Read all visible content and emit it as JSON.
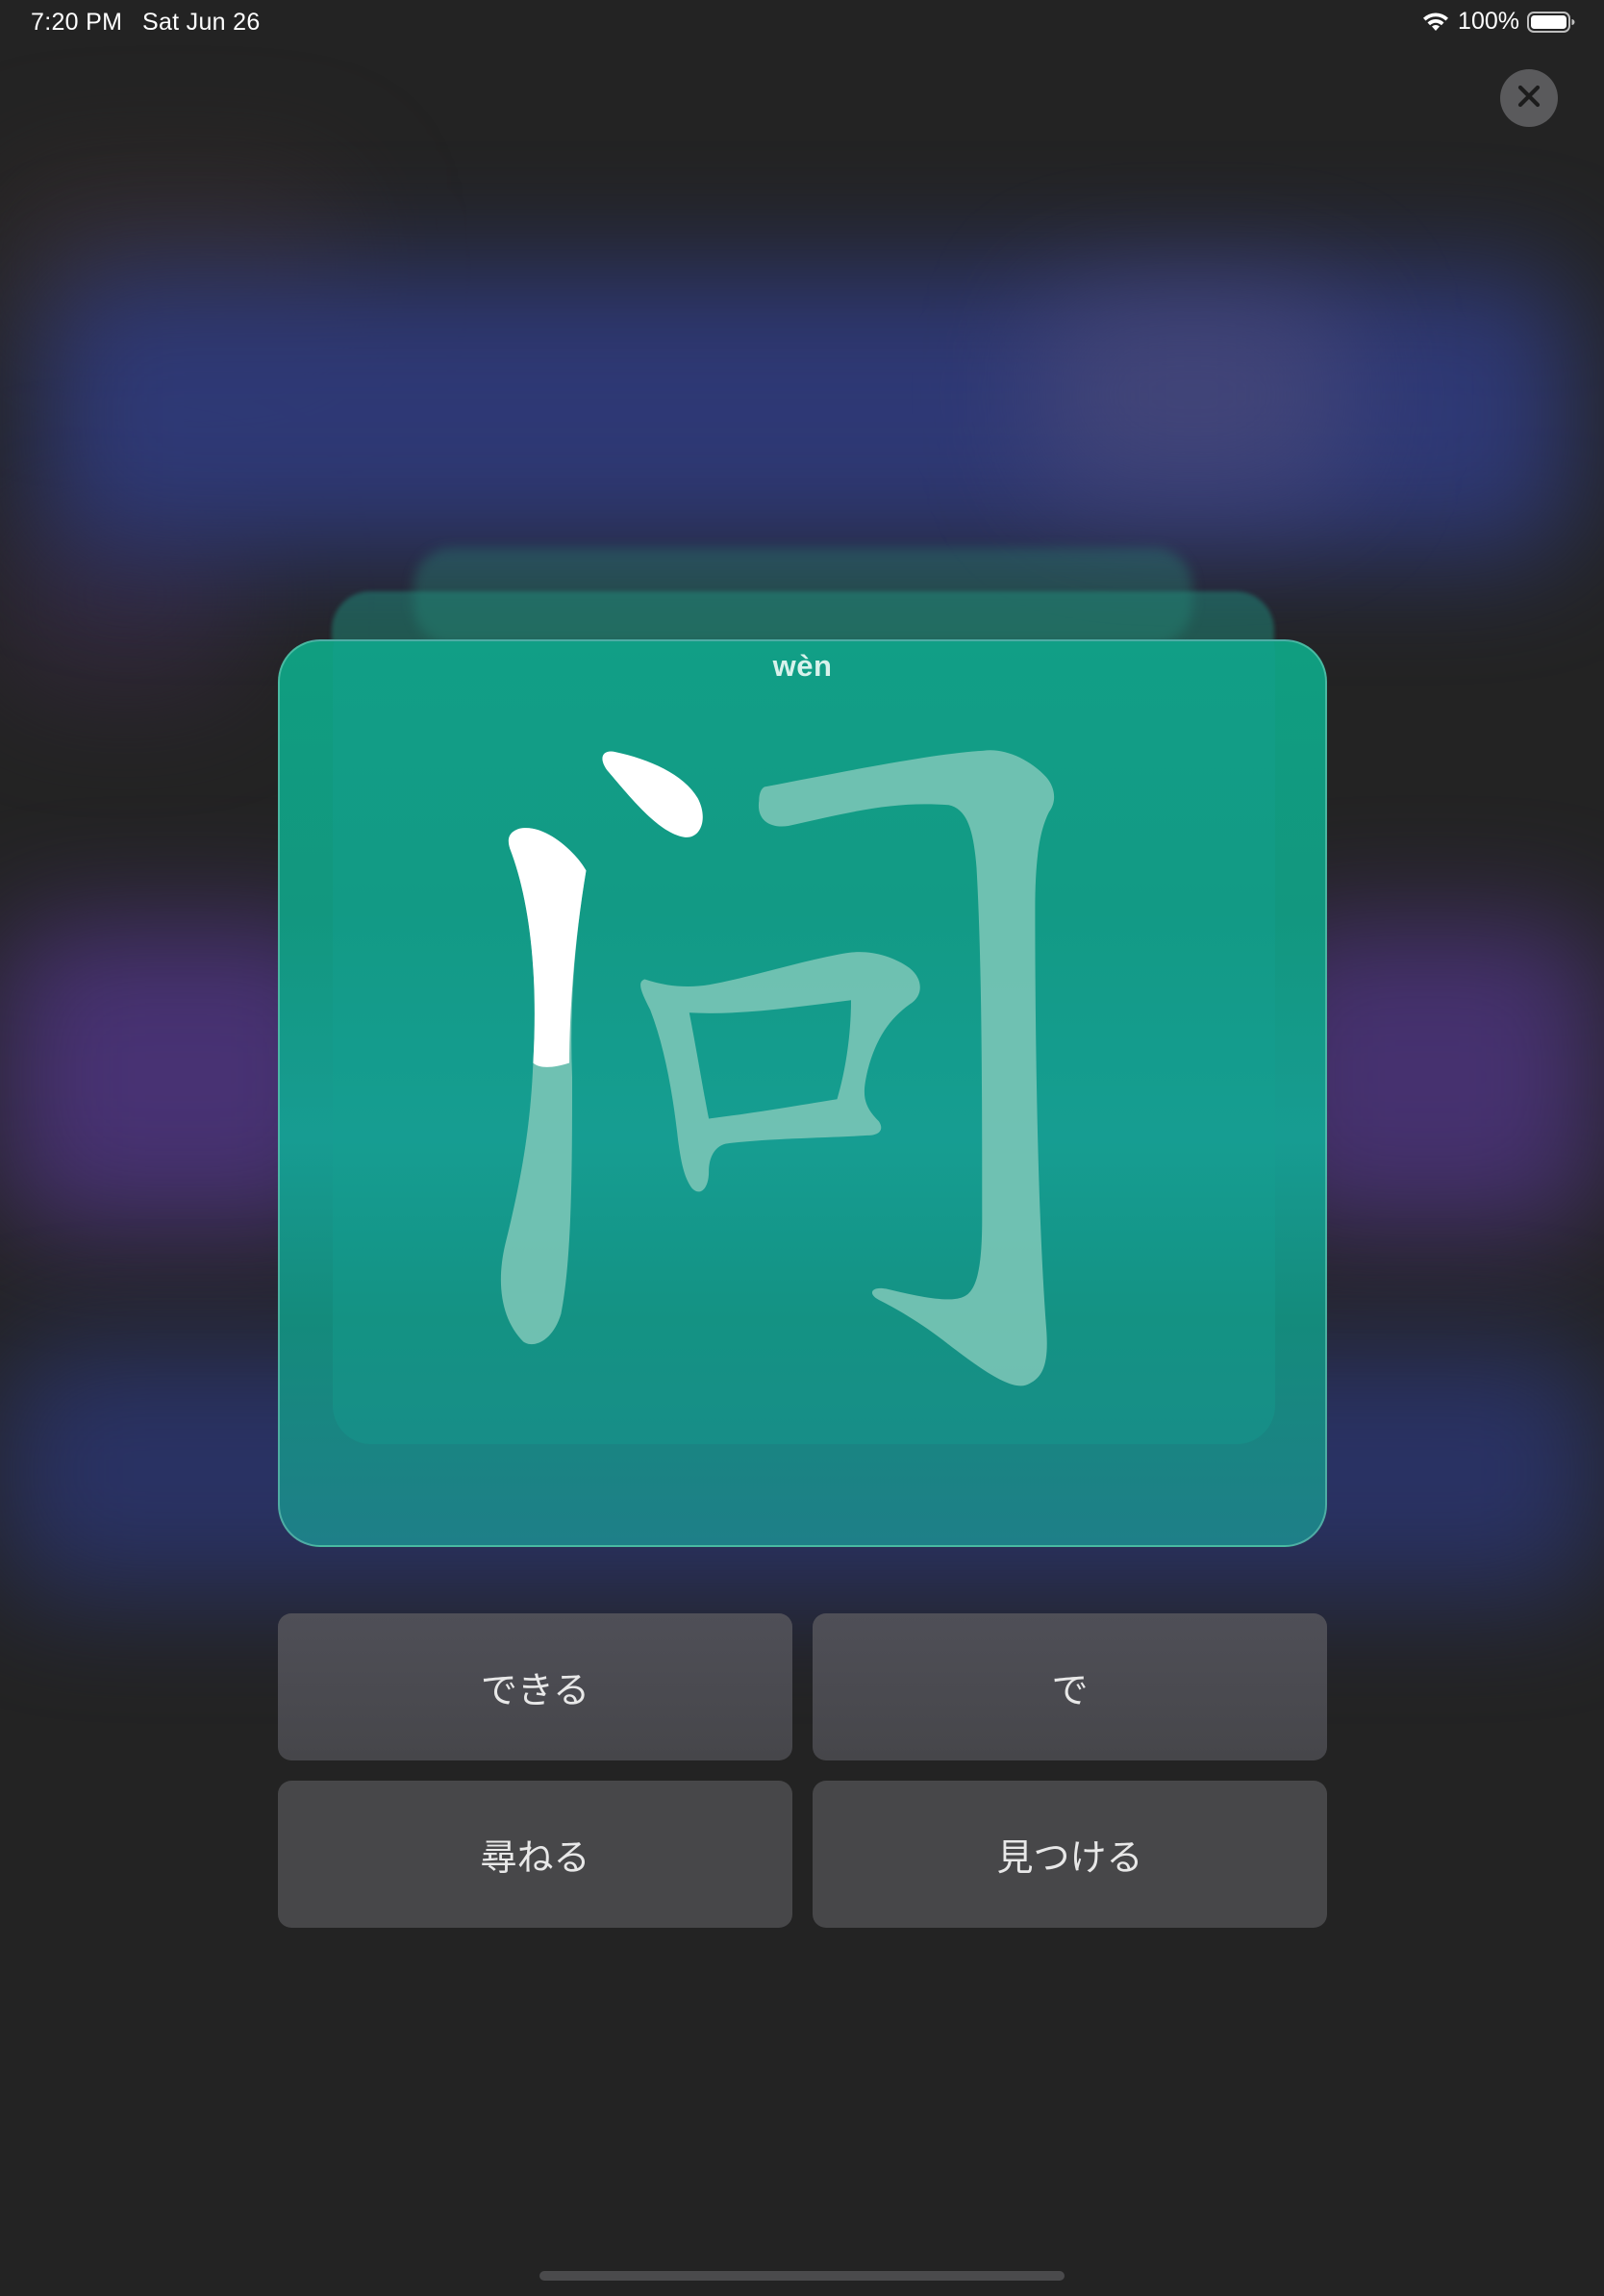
{
  "status_bar": {
    "time": "7:20 PM",
    "date": "Sat Jun 26",
    "battery": "100%"
  },
  "card": {
    "pinyin": "wèn",
    "character": "问",
    "character_color": "#7fc8b8",
    "highlight_color": "#ffffff"
  },
  "answers": [
    {
      "label": "できる"
    },
    {
      "label": "で"
    },
    {
      "label": "尋ねる"
    },
    {
      "label": "見つける"
    }
  ],
  "icons": {
    "close": "close-icon",
    "wifi": "wifi-icon",
    "battery": "battery-icon"
  }
}
